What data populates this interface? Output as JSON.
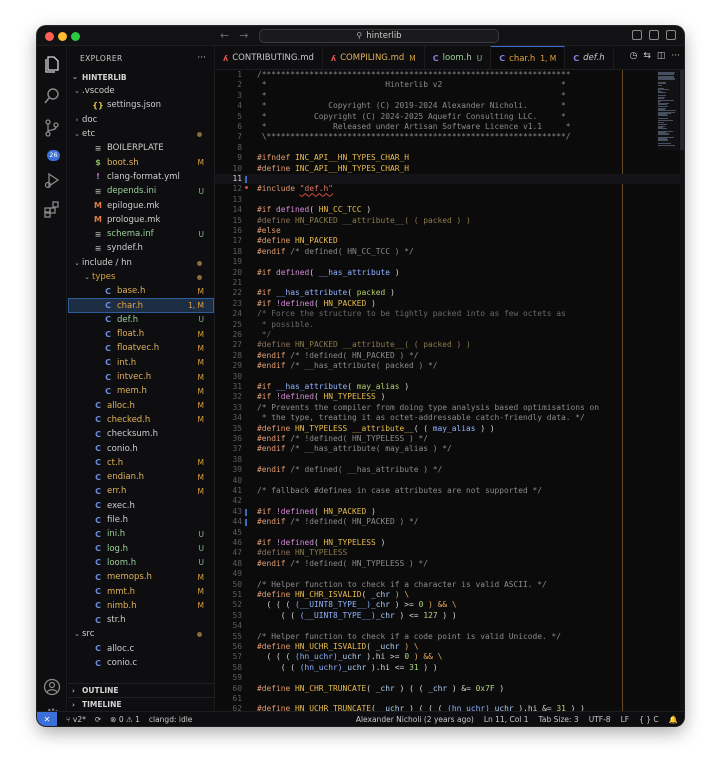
{
  "window": {
    "title": "hinterlib"
  },
  "sidebar": {
    "header": "EXPLORER",
    "more": "···",
    "root": "HINTERLIB",
    "rows": [
      {
        "indent": 0,
        "chev": "⌄",
        "icon": "",
        "label": ".vscode",
        "status": "",
        "dot": false,
        "kind": "folder"
      },
      {
        "indent": 1,
        "chev": "",
        "icon": "{}",
        "label": "settings.json",
        "status": "",
        "dot": false,
        "kind": "json"
      },
      {
        "indent": 0,
        "chev": "›",
        "icon": "",
        "label": "doc",
        "status": "",
        "dot": false,
        "kind": "folder"
      },
      {
        "indent": 0,
        "chev": "⌄",
        "icon": "",
        "label": "etc",
        "status": "",
        "dot": true,
        "kind": "folder"
      },
      {
        "indent": 1,
        "chev": "",
        "icon": "≡",
        "label": "BOILERPLATE",
        "status": "",
        "dot": false,
        "kind": "text"
      },
      {
        "indent": 1,
        "chev": "",
        "icon": "$",
        "label": "boot.sh",
        "status": "M",
        "dot": false,
        "kind": "sh"
      },
      {
        "indent": 1,
        "chev": "",
        "icon": "!",
        "label": "clang-format.yml",
        "status": "",
        "dot": false,
        "kind": "yml"
      },
      {
        "indent": 1,
        "chev": "",
        "icon": "≡",
        "label": "depends.ini",
        "status": "U",
        "dot": false,
        "kind": "ini"
      },
      {
        "indent": 1,
        "chev": "",
        "icon": "M",
        "label": "epilogue.mk",
        "status": "",
        "dot": false,
        "kind": "mk"
      },
      {
        "indent": 1,
        "chev": "",
        "icon": "M",
        "label": "prologue.mk",
        "status": "",
        "dot": false,
        "kind": "mk"
      },
      {
        "indent": 1,
        "chev": "",
        "icon": "≡",
        "label": "schema.inf",
        "status": "U",
        "dot": false,
        "kind": "ini"
      },
      {
        "indent": 1,
        "chev": "",
        "icon": "≡",
        "label": "syndef.h",
        "status": "",
        "dot": false,
        "kind": "text"
      },
      {
        "indent": 0,
        "chev": "⌄",
        "icon": "",
        "label": "include / hn",
        "status": "",
        "dot": true,
        "kind": "folder"
      },
      {
        "indent": 1,
        "chev": "⌄",
        "icon": "",
        "label": "types",
        "status": "",
        "dot": true,
        "kind": "folder-y"
      },
      {
        "indent": 2,
        "chev": "",
        "icon": "C",
        "label": "base.h",
        "status": "M",
        "dot": false,
        "kind": "c"
      },
      {
        "indent": 2,
        "chev": "",
        "icon": "C",
        "label": "char.h",
        "status": "1, M",
        "dot": false,
        "kind": "c",
        "selected": true
      },
      {
        "indent": 2,
        "chev": "",
        "icon": "C",
        "label": "def.h",
        "status": "U",
        "dot": false,
        "kind": "c"
      },
      {
        "indent": 2,
        "chev": "",
        "icon": "C",
        "label": "float.h",
        "status": "M",
        "dot": false,
        "kind": "c"
      },
      {
        "indent": 2,
        "chev": "",
        "icon": "C",
        "label": "floatvec.h",
        "status": "M",
        "dot": false,
        "kind": "c"
      },
      {
        "indent": 2,
        "chev": "",
        "icon": "C",
        "label": "int.h",
        "status": "M",
        "dot": false,
        "kind": "c"
      },
      {
        "indent": 2,
        "chev": "",
        "icon": "C",
        "label": "intvec.h",
        "status": "M",
        "dot": false,
        "kind": "c"
      },
      {
        "indent": 2,
        "chev": "",
        "icon": "C",
        "label": "mem.h",
        "status": "M",
        "dot": false,
        "kind": "c"
      },
      {
        "indent": 1,
        "chev": "",
        "icon": "C",
        "label": "alloc.h",
        "status": "M",
        "dot": false,
        "kind": "c"
      },
      {
        "indent": 1,
        "chev": "",
        "icon": "C",
        "label": "checked.h",
        "status": "M",
        "dot": false,
        "kind": "c"
      },
      {
        "indent": 1,
        "chev": "",
        "icon": "C",
        "label": "checksum.h",
        "status": "",
        "dot": false,
        "kind": "c"
      },
      {
        "indent": 1,
        "chev": "",
        "icon": "C",
        "label": "conio.h",
        "status": "",
        "dot": false,
        "kind": "c"
      },
      {
        "indent": 1,
        "chev": "",
        "icon": "C",
        "label": "ct.h",
        "status": "M",
        "dot": false,
        "kind": "c"
      },
      {
        "indent": 1,
        "chev": "",
        "icon": "C",
        "label": "endian.h",
        "status": "M",
        "dot": false,
        "kind": "c"
      },
      {
        "indent": 1,
        "chev": "",
        "icon": "C",
        "label": "err.h",
        "status": "M",
        "dot": false,
        "kind": "c"
      },
      {
        "indent": 1,
        "chev": "",
        "icon": "C",
        "label": "exec.h",
        "status": "",
        "dot": false,
        "kind": "c"
      },
      {
        "indent": 1,
        "chev": "",
        "icon": "C",
        "label": "file.h",
        "status": "",
        "dot": false,
        "kind": "c"
      },
      {
        "indent": 1,
        "chev": "",
        "icon": "C",
        "label": "ini.h",
        "status": "U",
        "dot": false,
        "kind": "c"
      },
      {
        "indent": 1,
        "chev": "",
        "icon": "C",
        "label": "log.h",
        "status": "U",
        "dot": false,
        "kind": "c"
      },
      {
        "indent": 1,
        "chev": "",
        "icon": "C",
        "label": "loom.h",
        "status": "U",
        "dot": false,
        "kind": "c"
      },
      {
        "indent": 1,
        "chev": "",
        "icon": "C",
        "label": "memops.h",
        "status": "M",
        "dot": false,
        "kind": "c"
      },
      {
        "indent": 1,
        "chev": "",
        "icon": "C",
        "label": "mmt.h",
        "status": "M",
        "dot": false,
        "kind": "c"
      },
      {
        "indent": 1,
        "chev": "",
        "icon": "C",
        "label": "nimb.h",
        "status": "M",
        "dot": false,
        "kind": "c"
      },
      {
        "indent": 1,
        "chev": "",
        "icon": "C",
        "label": "str.h",
        "status": "",
        "dot": false,
        "kind": "c"
      },
      {
        "indent": 0,
        "chev": "⌄",
        "icon": "",
        "label": "src",
        "status": "",
        "dot": true,
        "kind": "folder"
      },
      {
        "indent": 1,
        "chev": "",
        "icon": "C",
        "label": "alloc.c",
        "status": "",
        "dot": false,
        "kind": "c"
      },
      {
        "indent": 1,
        "chev": "",
        "icon": "C",
        "label": "conio.c",
        "status": "",
        "dot": false,
        "kind": "c"
      }
    ],
    "outline": "OUTLINE",
    "timeline": "TIMELINE"
  },
  "activity": {
    "scm_badge": "26"
  },
  "tabs": [
    {
      "icon": "ʎ",
      "label": "CONTRIBUTING.md",
      "mark": "",
      "active": false
    },
    {
      "icon": "ʎ",
      "label": "COMPILING.md",
      "mark": "M",
      "active": false
    },
    {
      "icon": "C",
      "label": "loom.h",
      "mark": "U",
      "active": false
    },
    {
      "icon": "C",
      "label": "char.h",
      "mark": "1, M",
      "active": true
    },
    {
      "icon": "C",
      "label": "def.h",
      "mark": "",
      "active": false
    }
  ],
  "editor": {
    "current_line": 11,
    "lines": [
      [
        {
          "t": "/*****************************************************************",
          "c": "c"
        }
      ],
      [
        {
          "t": " *                         Hinterlib v2                         *",
          "c": "c"
        }
      ],
      [
        {
          "t": " *                                                              *",
          "c": "c"
        }
      ],
      [
        {
          "t": " *             Copyright (C) 2019-2024 Alexander Nicholi.       *",
          "c": "c"
        }
      ],
      [
        {
          "t": " *          Copyright (C) 2024-2025 Aquefir Consulting LLC.     *",
          "c": "c"
        }
      ],
      [
        {
          "t": " *              Released under Artisan Software Licence v1.1     *",
          "c": "c"
        }
      ],
      [
        {
          "t": " \\***************************************************************/",
          "c": "c"
        }
      ],
      [],
      [
        {
          "t": "#ifndef ",
          "c": "pp"
        },
        {
          "t": "INC_API__HN_TYPES_CHAR_H",
          "c": "m"
        }
      ],
      [
        {
          "t": "#define ",
          "c": "pp"
        },
        {
          "t": "INC_API__HN_TYPES_CHAR_H",
          "c": "m"
        }
      ],
      [],
      [
        {
          "t": "#include ",
          "c": "pp"
        },
        {
          "t": "\"def.h\"",
          "c": "str"
        }
      ],
      [],
      [
        {
          "t": "#if ",
          "c": "pp"
        },
        {
          "t": "defined",
          "c": "kw"
        },
        {
          "t": "( ",
          "c": "p"
        },
        {
          "t": "HN_CC_TCC",
          "c": "m"
        },
        {
          "t": " )",
          "c": "p"
        }
      ],
      [
        {
          "t": "#define ",
          "c": "ppd"
        },
        {
          "t": "HN_PACKED __attribute__( ( packed ) )",
          "c": "md"
        }
      ],
      [
        {
          "t": "#else",
          "c": "pp"
        }
      ],
      [
        {
          "t": "#define ",
          "c": "pp"
        },
        {
          "t": "HN_PACKED",
          "c": "m"
        }
      ],
      [
        {
          "t": "#endif ",
          "c": "pp"
        },
        {
          "t": "/* defined( HN_CC_TCC ) */",
          "c": "c"
        }
      ],
      [],
      [
        {
          "t": "#if ",
          "c": "pp"
        },
        {
          "t": "defined",
          "c": "kw"
        },
        {
          "t": "( ",
          "c": "p"
        },
        {
          "t": "__has_attribute",
          "c": "fn"
        },
        {
          "t": " )",
          "c": "p"
        }
      ],
      [],
      [
        {
          "t": "#if ",
          "c": "pp"
        },
        {
          "t": "__has_attribute",
          "c": "fn"
        },
        {
          "t": "( ",
          "c": "p"
        },
        {
          "t": "packed",
          "c": "at"
        },
        {
          "t": " )",
          "c": "p"
        }
      ],
      [
        {
          "t": "#if ",
          "c": "pp"
        },
        {
          "t": "!defined",
          "c": "kw"
        },
        {
          "t": "( ",
          "c": "p"
        },
        {
          "t": "HN_PACKED",
          "c": "m"
        },
        {
          "t": " )",
          "c": "p"
        }
      ],
      [
        {
          "t": "/* Force the structure to be tightly packed into as few octets as",
          "c": "dim"
        }
      ],
      [
        {
          "t": " * possible.",
          "c": "dim"
        }
      ],
      [
        {
          "t": " */",
          "c": "dim"
        }
      ],
      [
        {
          "t": "#define ",
          "c": "ppd"
        },
        {
          "t": "HN_PACKED __attribute__( ( packed ) )",
          "c": "md"
        }
      ],
      [
        {
          "t": "#endif ",
          "c": "pp"
        },
        {
          "t": "/* !defined( HN_PACKED ) */",
          "c": "c"
        }
      ],
      [
        {
          "t": "#endif ",
          "c": "pp"
        },
        {
          "t": "/* __has_attribute( packed ) */",
          "c": "c"
        }
      ],
      [],
      [
        {
          "t": "#if ",
          "c": "pp"
        },
        {
          "t": "__has_attribute",
          "c": "fn"
        },
        {
          "t": "( ",
          "c": "p"
        },
        {
          "t": "may_alias",
          "c": "at"
        },
        {
          "t": " )",
          "c": "p"
        }
      ],
      [
        {
          "t": "#if ",
          "c": "pp"
        },
        {
          "t": "!defined",
          "c": "kw"
        },
        {
          "t": "( ",
          "c": "p"
        },
        {
          "t": "HN_TYPELESS",
          "c": "m"
        },
        {
          "t": " )",
          "c": "p"
        }
      ],
      [
        {
          "t": "/* Prevents the compiler from doing type analysis based optimisations on",
          "c": "c"
        }
      ],
      [
        {
          "t": " * the type, treating it as octet-addressable catch-friendly data. */",
          "c": "c"
        }
      ],
      [
        {
          "t": "#define ",
          "c": "pp"
        },
        {
          "t": "HN_TYPELESS __attribute__",
          "c": "m"
        },
        {
          "t": "( ( ",
          "c": "p"
        },
        {
          "t": "may_alias",
          "c": "fn"
        },
        {
          "t": " ) )",
          "c": "p"
        }
      ],
      [
        {
          "t": "#endif ",
          "c": "pp"
        },
        {
          "t": "/* !defined( HN_TYPELESS ) */",
          "c": "c"
        }
      ],
      [
        {
          "t": "#endif ",
          "c": "pp"
        },
        {
          "t": "/* __has_attribute( may_alias ) */",
          "c": "c"
        }
      ],
      [],
      [
        {
          "t": "#endif ",
          "c": "pp"
        },
        {
          "t": "/* defined( __has_attribute ) */",
          "c": "c"
        }
      ],
      [],
      [
        {
          "t": "/* fallback #defines in case attributes are not supported */",
          "c": "c"
        }
      ],
      [],
      [
        {
          "t": "#if ",
          "c": "pp"
        },
        {
          "t": "!defined",
          "c": "kw"
        },
        {
          "t": "( ",
          "c": "p"
        },
        {
          "t": "HN_PACKED",
          "c": "m"
        },
        {
          "t": " )",
          "c": "p"
        }
      ],
      [
        {
          "t": "#endif ",
          "c": "pp"
        },
        {
          "t": "/* !defined( HN_PACKED ) */",
          "c": "c"
        }
      ],
      [],
      [
        {
          "t": "#if ",
          "c": "pp"
        },
        {
          "t": "!defined",
          "c": "kw"
        },
        {
          "t": "( ",
          "c": "p"
        },
        {
          "t": "HN_TYPELESS",
          "c": "m"
        },
        {
          "t": " )",
          "c": "p"
        }
      ],
      [
        {
          "t": "#define ",
          "c": "ppd"
        },
        {
          "t": "HN_TYPELESS",
          "c": "md"
        }
      ],
      [
        {
          "t": "#endif ",
          "c": "pp"
        },
        {
          "t": "/* !defined( HN_TYPELESS ) */",
          "c": "c"
        }
      ],
      [],
      [
        {
          "t": "/* Helper function to check if a character is valid ASCII. */",
          "c": "c"
        }
      ],
      [
        {
          "t": "#define ",
          "c": "pp"
        },
        {
          "t": "HN_CHR_ISVALID",
          "c": "m"
        },
        {
          "t": "( ",
          "c": "p"
        },
        {
          "t": "_chr",
          "c": "var"
        },
        {
          "t": " ) \\",
          "c": "op"
        }
      ],
      [
        {
          "t": "  ( ( ( ",
          "c": "p"
        },
        {
          "t": "(__UINT8_TYPE__)",
          "c": "fn"
        },
        {
          "t": "_chr",
          "c": "var"
        },
        {
          "t": " ) >= ",
          "c": "p"
        },
        {
          "t": "0",
          "c": "num"
        },
        {
          "t": " ) && \\",
          "c": "op"
        }
      ],
      [
        {
          "t": "     ( ( ",
          "c": "p"
        },
        {
          "t": "(__UINT8_TYPE__)",
          "c": "fn"
        },
        {
          "t": "_chr",
          "c": "var"
        },
        {
          "t": " ) <= ",
          "c": "p"
        },
        {
          "t": "127",
          "c": "num"
        },
        {
          "t": " ) )",
          "c": "p"
        }
      ],
      [],
      [
        {
          "t": "/* Helper function to check if a code point is valid Unicode. */",
          "c": "c"
        }
      ],
      [
        {
          "t": "#define ",
          "c": "pp"
        },
        {
          "t": "HN_UCHR_ISVALID",
          "c": "m"
        },
        {
          "t": "( ",
          "c": "p"
        },
        {
          "t": "_uchr",
          "c": "var"
        },
        {
          "t": " ) \\",
          "c": "op"
        }
      ],
      [
        {
          "t": "  ( ( ( ",
          "c": "p"
        },
        {
          "t": "(hn_uchr)",
          "c": "fn"
        },
        {
          "t": "_uchr",
          "c": "var"
        },
        {
          "t": " ).hi >= ",
          "c": "p"
        },
        {
          "t": "0",
          "c": "num"
        },
        {
          "t": " ) && \\",
          "c": "op"
        }
      ],
      [
        {
          "t": "     ( ( ",
          "c": "p"
        },
        {
          "t": "(hn_uchr)",
          "c": "fn"
        },
        {
          "t": "_uchr",
          "c": "var"
        },
        {
          "t": " ).hi <= ",
          "c": "p"
        },
        {
          "t": "31",
          "c": "num"
        },
        {
          "t": " ) )",
          "c": "p"
        }
      ],
      [],
      [
        {
          "t": "#define ",
          "c": "pp"
        },
        {
          "t": "HN_CHR_TRUNCATE",
          "c": "m"
        },
        {
          "t": "( ",
          "c": "p"
        },
        {
          "t": "_chr",
          "c": "var"
        },
        {
          "t": " ) ( ( ",
          "c": "p"
        },
        {
          "t": "_chr",
          "c": "var"
        },
        {
          "t": " ) &= ",
          "c": "p"
        },
        {
          "t": "0x7F",
          "c": "num"
        },
        {
          "t": " )",
          "c": "p"
        }
      ],
      [],
      [
        {
          "t": "#define ",
          "c": "pp"
        },
        {
          "t": "HN_UCHR_TRUNCATE",
          "c": "m"
        },
        {
          "t": "( ",
          "c": "p"
        },
        {
          "t": "_uchr",
          "c": "var"
        },
        {
          "t": " ) ( ( ( ",
          "c": "p"
        },
        {
          "t": "(hn_uchr)",
          "c": "fn"
        },
        {
          "t": "_uchr",
          "c": "var"
        },
        {
          "t": " ).hi &= ",
          "c": "p"
        },
        {
          "t": "31",
          "c": "num"
        },
        {
          "t": " ) )",
          "c": "p"
        }
      ]
    ]
  },
  "statusbar": {
    "remote": "✕",
    "branch": "v2*",
    "sync": "⟳",
    "problems": "⊗ 0  ⚠ 1",
    "clangd": "clangd: idle",
    "blame": "Alexander Nicholi (2 years ago)",
    "position": "Ln 11, Col 1",
    "tabsize": "Tab Size: 3",
    "encoding": "UTF-8",
    "eol": "LF",
    "language": "{ } C",
    "bell": "🔔"
  },
  "colors": {
    "accent": "#3b6fd9",
    "modified": "#d9a13d",
    "untracked": "#7fc07f"
  }
}
